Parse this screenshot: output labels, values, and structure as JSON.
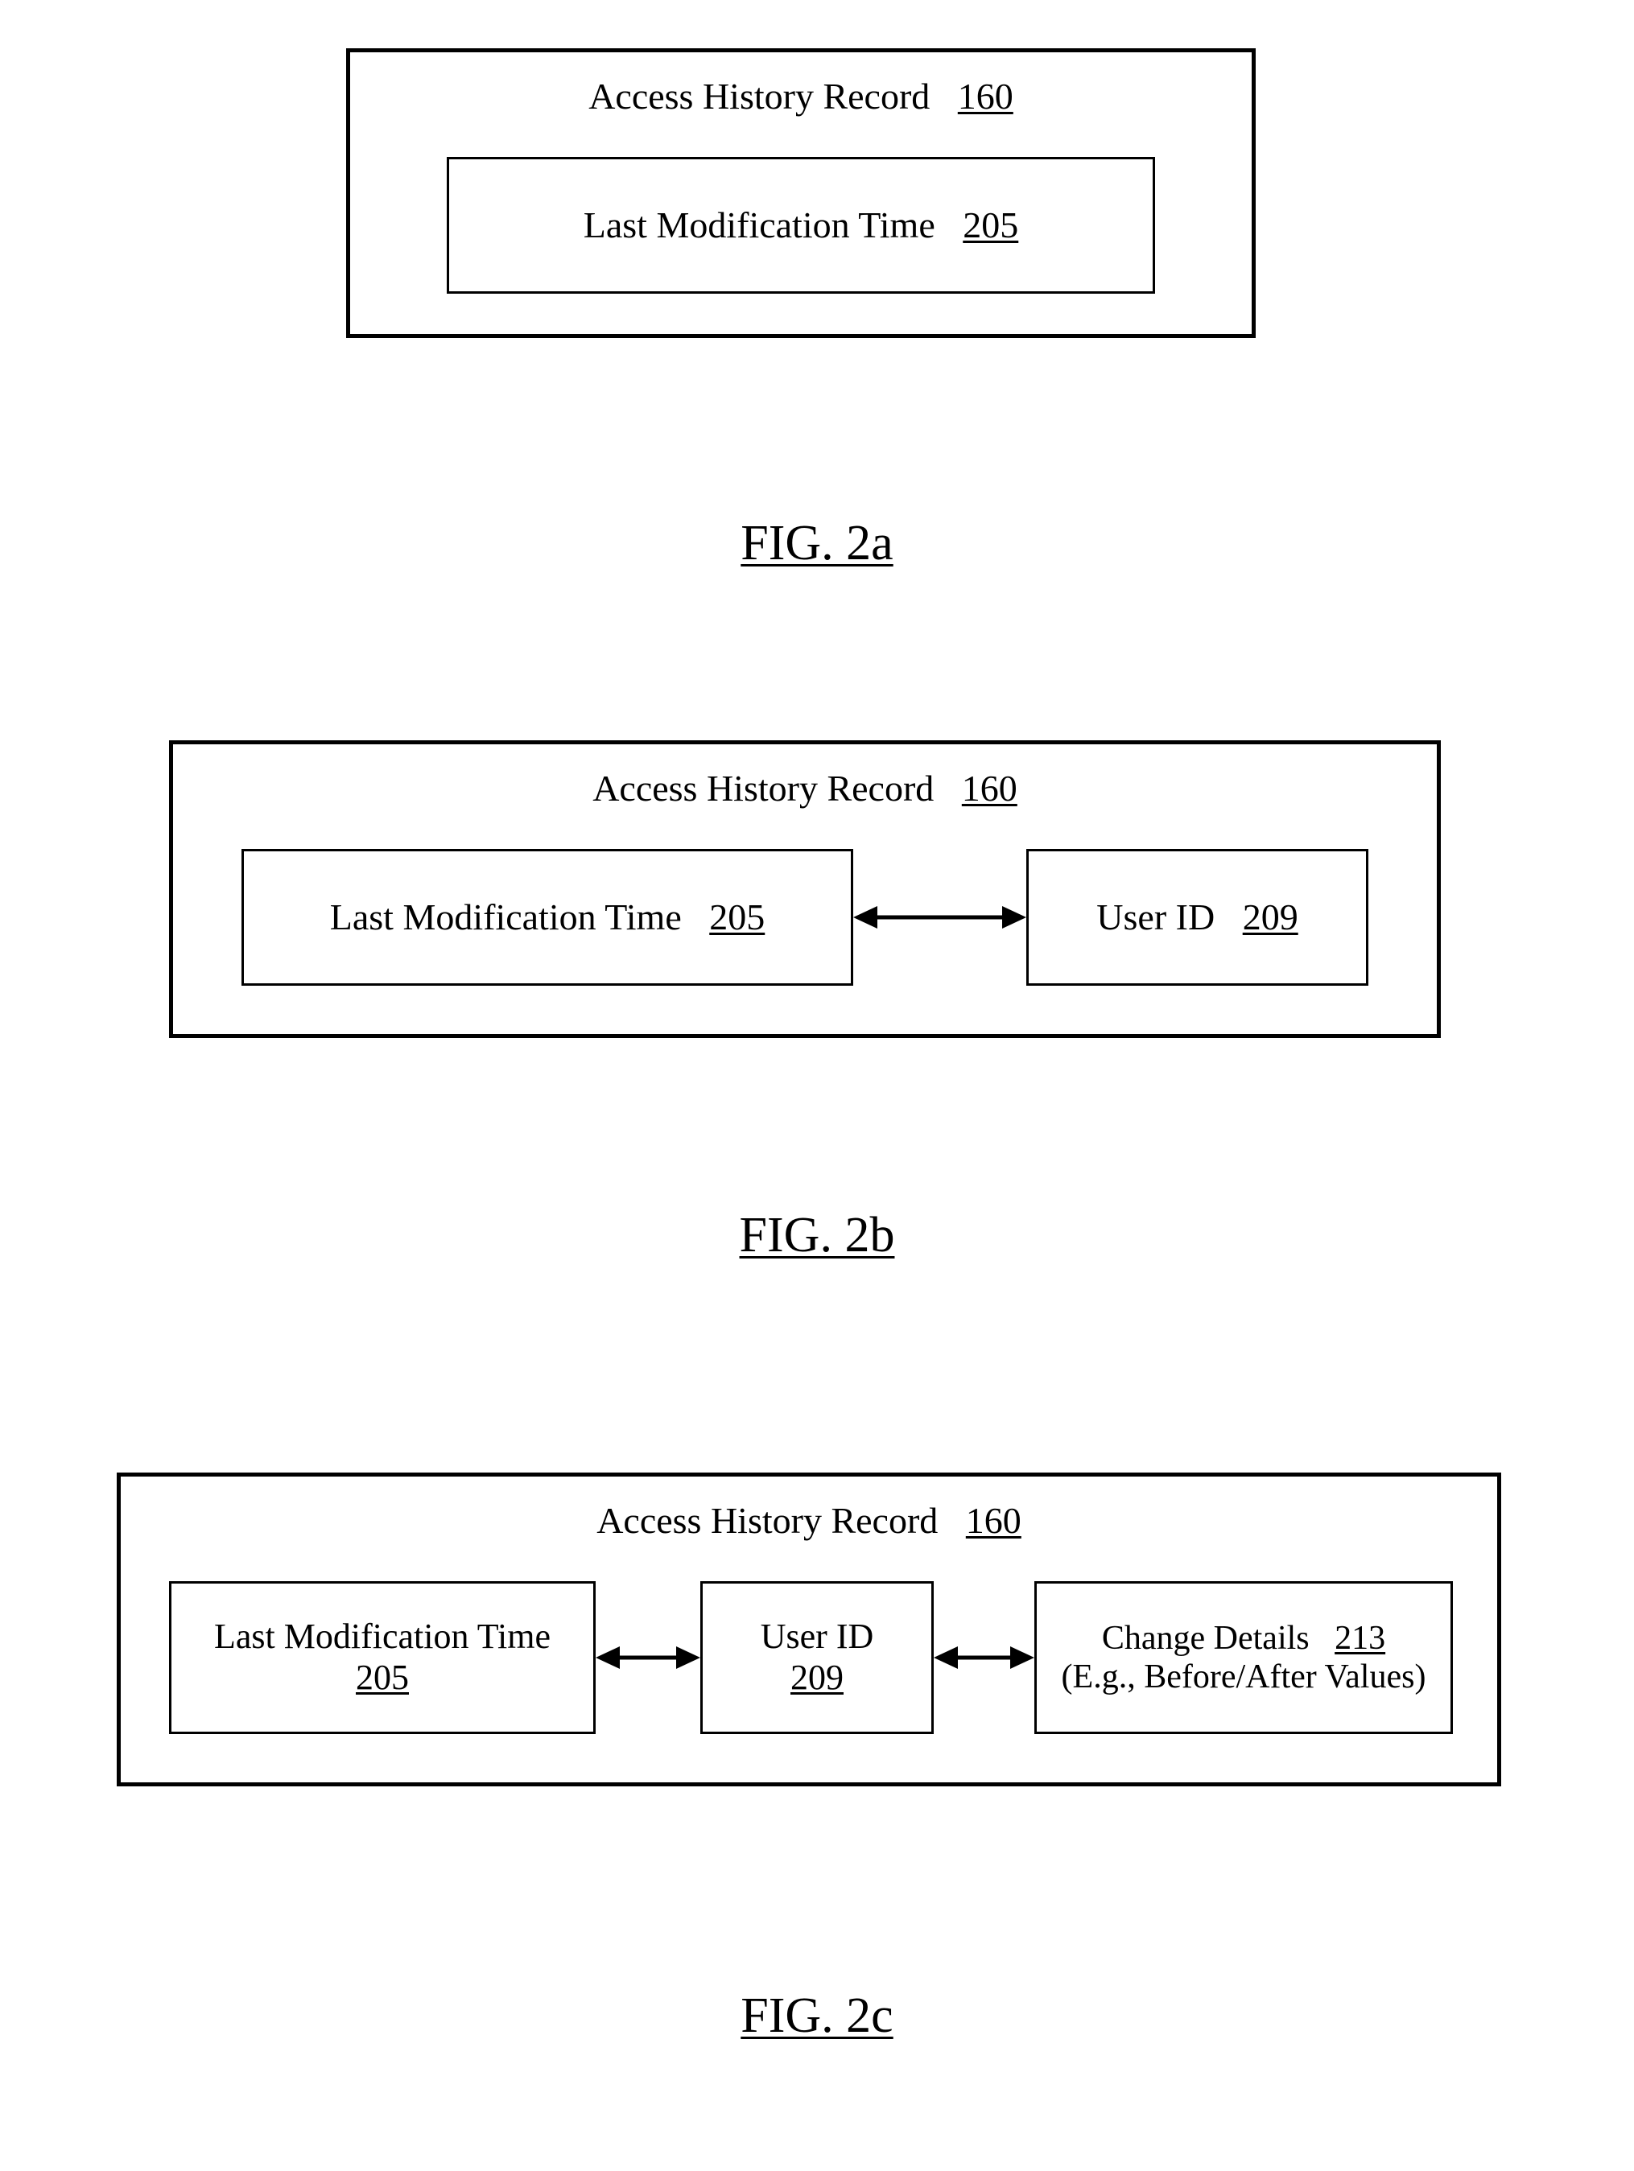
{
  "common": {
    "record_label": "Access History Record",
    "record_ref": "160",
    "lmt_label": "Last Modification Time",
    "lmt_ref": "205",
    "uid_label": "User ID",
    "uid_ref": "209",
    "cd_label": "Change Details",
    "cd_ref": "213",
    "cd_example": "(E.g., Before/After Values)"
  },
  "captions": {
    "a": "FIG. 2a",
    "b": "FIG. 2b",
    "c": "FIG. 2c"
  }
}
